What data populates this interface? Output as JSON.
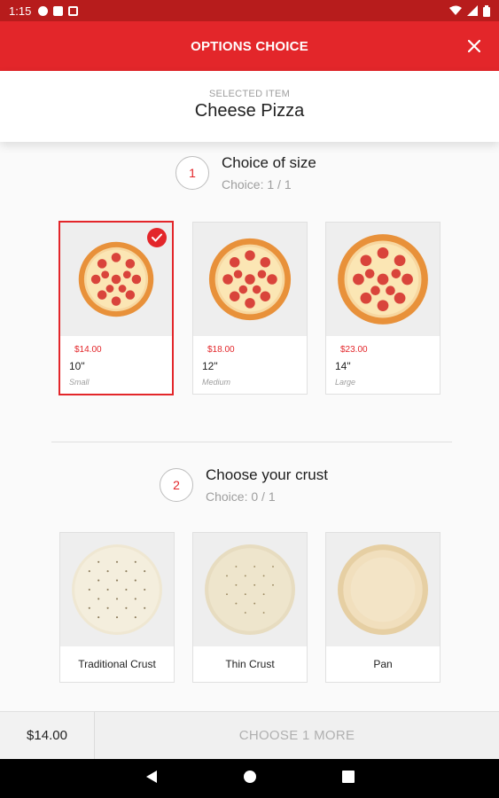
{
  "status_bar": {
    "time": "1:15"
  },
  "header": {
    "title": "OPTIONS CHOICE"
  },
  "selected_item": {
    "label": "SELECTED ITEM",
    "name": "Cheese Pizza"
  },
  "sections": [
    {
      "step": "1",
      "title": "Choice of size",
      "choice": "Choice: 1 / 1"
    },
    {
      "step": "2",
      "title": "Choose your crust",
      "choice": "Choice: 0 / 1"
    }
  ],
  "sizes": [
    {
      "price": "$14.00",
      "size": "10\"",
      "note": "Small",
      "selected": true
    },
    {
      "price": "$18.00",
      "size": "12\"",
      "note": "Medium",
      "selected": false
    },
    {
      "price": "$23.00",
      "size": "14\"",
      "note": "Large",
      "selected": false
    }
  ],
  "crusts": [
    {
      "label": "Traditional Crust"
    },
    {
      "label": "Thin Crust"
    },
    {
      "label": "Pan"
    }
  ],
  "footer": {
    "total": "$14.00",
    "action": "CHOOSE 1 MORE"
  },
  "colors": {
    "brand_red": "#e3262a",
    "status_red": "#b71c1c"
  },
  "icons": [
    "message-icon",
    "sim-icon",
    "sync-icon",
    "wifi-icon",
    "signal-icon",
    "battery-icon",
    "close-icon",
    "check-icon",
    "pizza-icon",
    "crust-icon",
    "back-icon",
    "home-icon",
    "recents-icon"
  ]
}
